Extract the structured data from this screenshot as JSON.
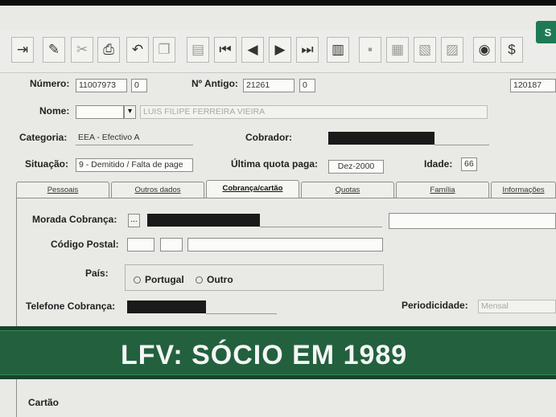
{
  "toolbar": {
    "icons": [
      "exit-icon",
      "pencil-icon",
      "scissors-icon",
      "print-icon",
      "undo-icon",
      "copy-icon",
      "paste-icon",
      "first-record-icon",
      "prev-record-icon",
      "next-record-icon",
      "last-record-icon",
      "notebook-icon",
      "calculator-icon",
      "card-icon",
      "drawer-icon",
      "cash-register-icon",
      "person-icon",
      "dollar-icon"
    ],
    "glyphs": {
      "exit": "⇥",
      "pencil": "✎",
      "scissors": "✂",
      "print": "⎙",
      "undo": "↶",
      "copy": "❐",
      "paste": "▤",
      "first": "⏮",
      "prev": "◀",
      "next": "▶",
      "last": "⏭",
      "notebook": "▥",
      "calc": "▪",
      "card": "▦",
      "drawer": "▧",
      "register": "▨",
      "person": "◉",
      "dollar": "$"
    },
    "corner_label": "S"
  },
  "form": {
    "numero_label": "Número:",
    "numero_value": "11007973",
    "numero_sub": "0",
    "antigo_label": "Nº Antigo:",
    "antigo_value": "21261",
    "antigo_sub": "0",
    "right_value": "120187",
    "nome_label": "Nome:",
    "nome_value": "LUIS FILIPE FERREIRA VIEIRA",
    "categoria_label": "Categoria:",
    "categoria_value": "EEA - Efectivo A",
    "cobrador_label": "Cobrador:",
    "situacao_label": "Situação:",
    "situacao_value": "9 - Demitido / Falta de page",
    "quota_label": "Última quota paga:",
    "quota_value": "Dez-2000",
    "idade_label": "Idade:",
    "idade_value": "66"
  },
  "tabs": [
    {
      "label": "Pessoais"
    },
    {
      "label": "Outros dados"
    },
    {
      "label": "Cobrança/cartão",
      "active": true
    },
    {
      "label": "Quotas"
    },
    {
      "label": "Família"
    },
    {
      "label": "Informações"
    }
  ],
  "cobranca": {
    "morada_label": "Morada Cobrança:",
    "morada_button": "...",
    "codigo_label": "Código Postal:",
    "pais_label": "País:",
    "pais_options": [
      "Portugal",
      "Outro"
    ],
    "telefone_label": "Telefone Cobrança:",
    "periodicidade_label": "Periodicidade:",
    "periodicidade_value": "Mensal",
    "cartao_label": "Cartão"
  },
  "banner": {
    "text": "LFV: SÓCIO EM 1989"
  }
}
